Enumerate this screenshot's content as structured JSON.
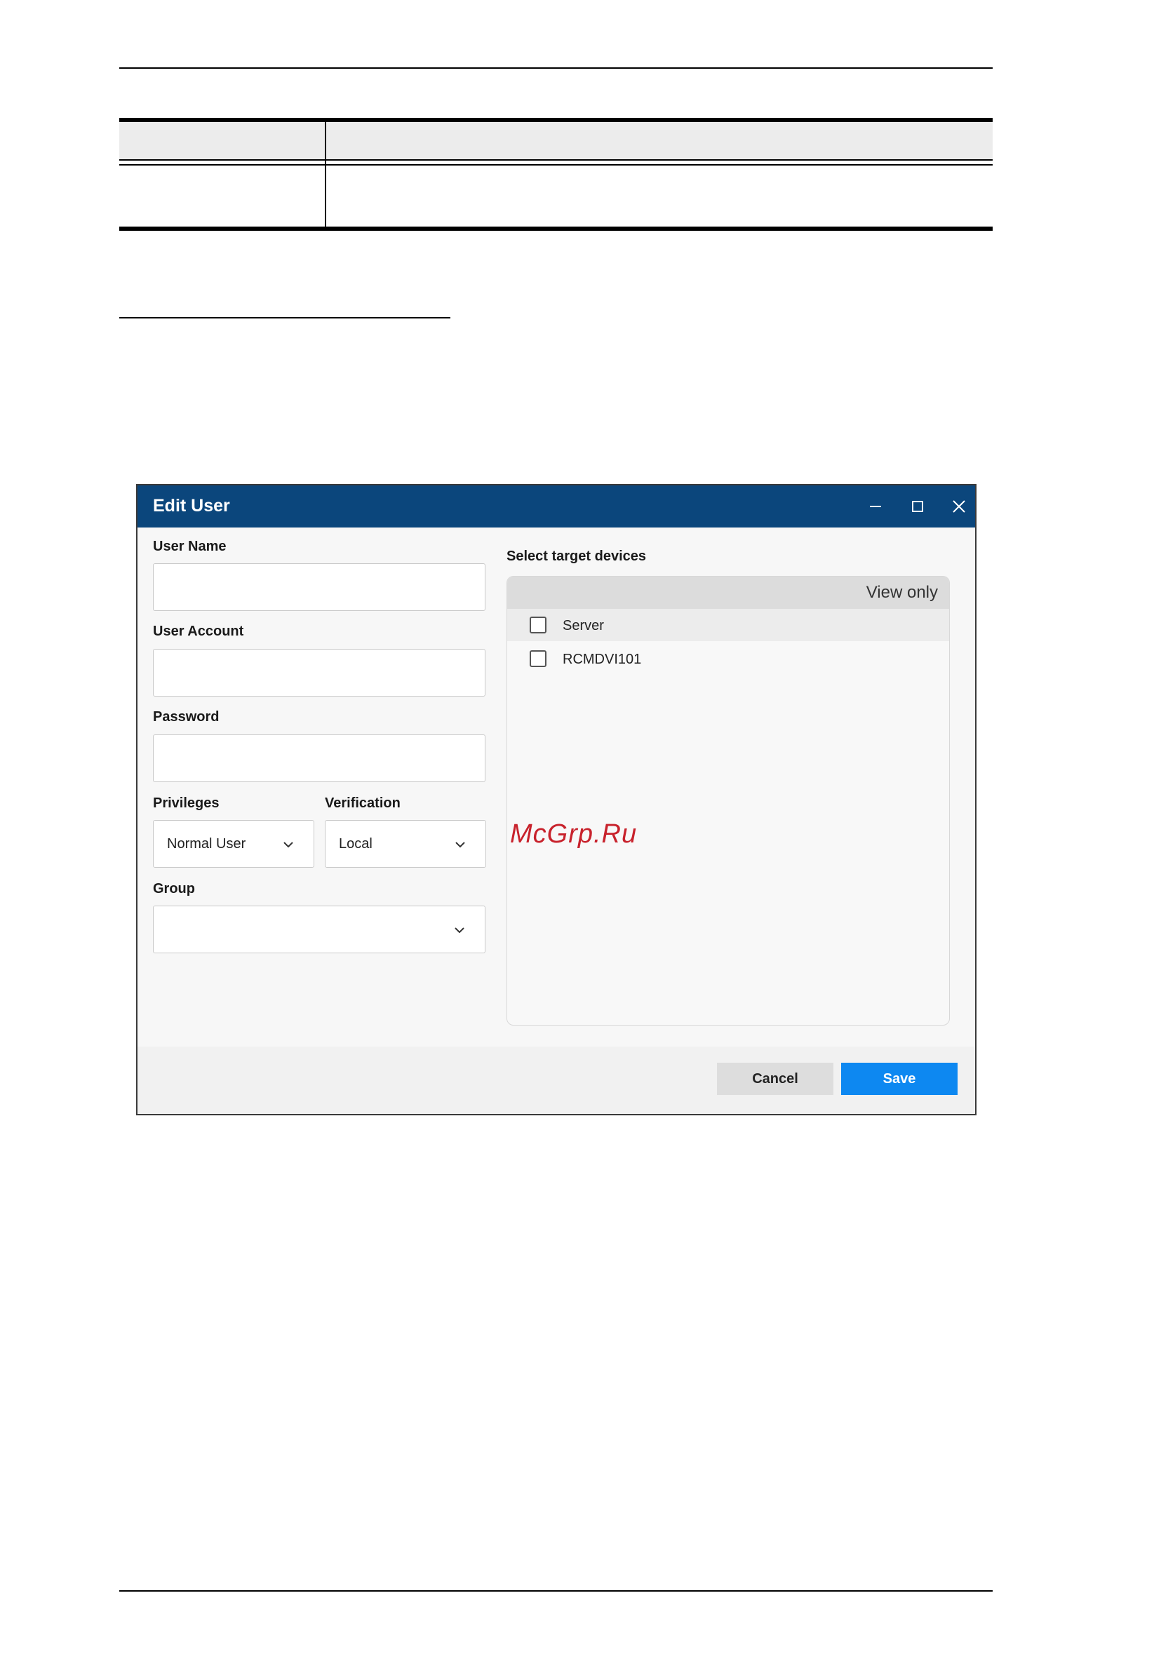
{
  "dialog": {
    "title": "Edit User",
    "fields": {
      "user_name": {
        "label": "User Name",
        "value": ""
      },
      "user_account": {
        "label": "User Account",
        "value": ""
      },
      "password": {
        "label": "Password",
        "value": ""
      },
      "privileges": {
        "label": "Privileges",
        "selected": "Normal User"
      },
      "verification": {
        "label": "Verification",
        "selected": "Local"
      },
      "group": {
        "label": "Group",
        "selected": ""
      }
    },
    "devices": {
      "label": "Select target devices",
      "header": "View only",
      "items": [
        {
          "name": "Server",
          "checked": false
        },
        {
          "name": "RCMDVI101",
          "checked": false
        }
      ]
    },
    "buttons": {
      "cancel": "Cancel",
      "save": "Save"
    }
  },
  "watermark": "McGrp.Ru",
  "colors": {
    "titlebar": "#0b467c",
    "save_button": "#0d88f1",
    "cancel_button": "#dddddd",
    "watermark": "#c8222c"
  }
}
